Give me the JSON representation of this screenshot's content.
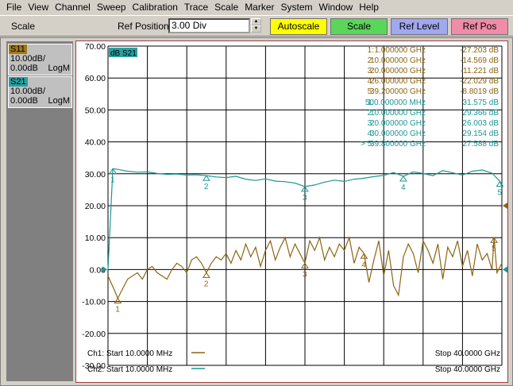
{
  "menu": [
    "File",
    "View",
    "Channel",
    "Sweep",
    "Calibration",
    "Trace",
    "Scale",
    "Marker",
    "System",
    "Window",
    "Help"
  ],
  "toolbar": {
    "section": "Scale",
    "refpos_label": "Ref Position",
    "refpos_value": "3.00 Div",
    "autoscale": "Autoscale",
    "scale": "Scale",
    "ref_level": "Ref Level",
    "ref_pos": "Ref Pos"
  },
  "traces": [
    {
      "name": "S11",
      "scale": "10.00dB/",
      "ref": "0.00dB",
      "format": "LogM",
      "color": "#8c6414"
    },
    {
      "name": "S21",
      "scale": "10.00dB/",
      "ref": "0.00dB",
      "format": "LogM",
      "color": "#1e9696"
    }
  ],
  "plot": {
    "active_label": "dB S21",
    "ch1_start": "Ch1: Start  10.0000 MHz",
    "ch1_stop": "Stop  40.0000 GHz",
    "ch2_start": "Ch2: Start  10.0000 MHz",
    "ch2_stop": "Stop  40.0000 GHz"
  },
  "markers_s11": [
    {
      "label": "1:",
      "freq": "1.000000 GHz",
      "value": "-27.203 dB"
    },
    {
      "label": "2:",
      "freq": "10.000000 GHz",
      "value": "-14.569 dB"
    },
    {
      "label": "3:",
      "freq": "20.000000 GHz",
      "value": "-11.221 dB"
    },
    {
      "label": "4:",
      "freq": "26.000000 GHz",
      "value": "-22.029 dB"
    },
    {
      "label": "5:",
      "freq": "39.200000 GHz",
      "value": "-8.8019 dB"
    }
  ],
  "markers_s21": [
    {
      "label": "1:",
      "freq": "500.000000 MHz",
      "value": "31.575 dB"
    },
    {
      "label": "2:",
      "freq": "10.000000 GHz",
      "value": "29.366 dB"
    },
    {
      "label": "3:",
      "freq": "20.000000 GHz",
      "value": "26.003 dB"
    },
    {
      "label": "4:",
      "freq": "30.000000 GHz",
      "value": "29.154 dB"
    },
    {
      "label": "> 5:",
      "freq": "39.800000 GHz",
      "value": "27.588 dB"
    }
  ],
  "chart_data": {
    "type": "line",
    "ytick_labels": [
      "70.00",
      "60.00",
      "50.00",
      "40.00",
      "30.00",
      "20.00",
      "10.00",
      "0.00",
      "-10.00",
      "-20.00",
      "-30.00"
    ],
    "ylim": [
      -30,
      70
    ],
    "xlim": [
      0.01,
      40
    ],
    "x_unit": "GHz",
    "grid": true,
    "series": [
      {
        "name": "S11",
        "color": "#8c6414",
        "x": [
          0.01,
          0.3,
          0.6,
          1.0,
          1.5,
          2.0,
          2.5,
          3.0,
          3.5,
          4.0,
          4.5,
          5.0,
          5.5,
          6.0,
          6.5,
          7.0,
          7.5,
          8.0,
          8.5,
          9.0,
          9.5,
          10.0,
          10.5,
          11,
          11.5,
          12,
          12.5,
          13,
          13.5,
          14,
          14.5,
          15,
          15.5,
          16,
          16.5,
          17,
          17.5,
          18,
          18.5,
          19,
          19.5,
          20,
          20.5,
          21,
          21.5,
          22,
          22.5,
          23,
          23.5,
          24,
          24.5,
          25,
          25.5,
          26,
          26.5,
          27,
          27.5,
          28,
          28.5,
          29,
          29.5,
          30,
          30.5,
          31,
          31.5,
          32,
          32.5,
          33,
          33.5,
          34,
          34.5,
          35,
          35.5,
          36,
          36.5,
          37,
          37.5,
          38,
          38.5,
          39,
          39.2,
          39.5,
          40
        ],
        "y": [
          -2,
          -4,
          -6,
          -9,
          -6,
          -3,
          -2,
          -1,
          -3,
          0,
          1,
          -1,
          -2,
          -3,
          0,
          2,
          1,
          -1,
          3,
          4,
          2,
          -1,
          2,
          4,
          3,
          5,
          2,
          6,
          3,
          8,
          4,
          7,
          1,
          6,
          9,
          3,
          7,
          10,
          4,
          8,
          5,
          2,
          9,
          6,
          10,
          3,
          7,
          4,
          8,
          6,
          10,
          2,
          7,
          5,
          -4,
          3,
          9,
          -2,
          6,
          -5,
          -8,
          4,
          8,
          5,
          -1,
          9,
          6,
          2,
          8,
          -3,
          7,
          4,
          9,
          1,
          6,
          -2,
          8,
          3,
          5,
          0,
          10,
          -1,
          2
        ]
      },
      {
        "name": "S21",
        "color": "#1e9696",
        "x": [
          0.01,
          0.5,
          1,
          2,
          3,
          4,
          5,
          6,
          7,
          8,
          9,
          10,
          11,
          12,
          13,
          14,
          15,
          16,
          17,
          18,
          19,
          20,
          21,
          22,
          23,
          24,
          25,
          26,
          27,
          28,
          29,
          30,
          31,
          32,
          33,
          34,
          35,
          36,
          37,
          38,
          39,
          39.8,
          40
        ],
        "y": [
          0,
          31.6,
          31.4,
          30.8,
          30.5,
          30.6,
          30.1,
          29.8,
          29.9,
          29.6,
          29.7,
          29.4,
          29.0,
          28.8,
          29.2,
          28.3,
          27.9,
          28.4,
          27.7,
          27.5,
          27.1,
          26.0,
          26.5,
          27.4,
          28.0,
          27.6,
          28.3,
          28.6,
          29.1,
          29.5,
          30.4,
          29.2,
          30.6,
          30.1,
          29.4,
          31.0,
          30.3,
          29.6,
          30.8,
          31.2,
          30.2,
          27.6,
          26.0
        ]
      }
    ],
    "markers_s11_x": [
      1,
      10,
      20,
      26,
      39.2
    ],
    "markers_s21_x": [
      0.5,
      10,
      20,
      30,
      39.8
    ]
  }
}
